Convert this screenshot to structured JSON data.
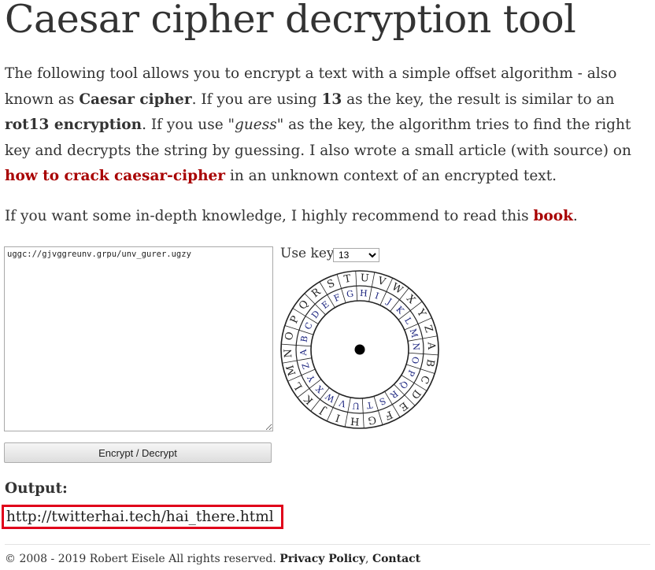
{
  "page": {
    "title": "Caesar cipher decryption tool"
  },
  "intro": {
    "t1": "The following tool allows you to encrypt a text with a simple offset algorithm - also known as ",
    "b1": "Caesar cipher",
    "t2": ". If you are using ",
    "b2": "13",
    "t3": " as the key, the result is similar to an ",
    "b3": "rot13 encryption",
    "t4": ". If you use ",
    "i1": "\"guess\"",
    "t5": " as the key, the algorithm tries to find the right key and decrypts the string by guessing. I also wrote a small article (with source) on ",
    "link1": "how to crack caesar-cipher",
    "t6": " in an unknown context of an encrypted text."
  },
  "intro2": {
    "t1": "If you want some in-depth knowledge, I highly recommend to read this ",
    "link": "book",
    "t2": "."
  },
  "tool": {
    "input_value": "uggc://gjvggreunv.grpu/unv_gurer.ugzy",
    "key_label": "Use key:",
    "key_selected": "13",
    "button_label": "Encrypt / Decrypt",
    "wheel": {
      "outer_letters": [
        "A",
        "B",
        "C",
        "D",
        "E",
        "F",
        "G",
        "H",
        "I",
        "J",
        "K",
        "L",
        "M",
        "N",
        "O",
        "P",
        "Q",
        "R",
        "S",
        "T",
        "U",
        "V",
        "W",
        "X",
        "Y",
        "Z"
      ],
      "inner_letters": [
        "N",
        "O",
        "P",
        "Q",
        "R",
        "S",
        "T",
        "U",
        "V",
        "W",
        "X",
        "Y",
        "Z",
        "A",
        "B",
        "C",
        "D",
        "E",
        "F",
        "G",
        "H",
        "I",
        "J",
        "K",
        "L",
        "M"
      ],
      "accent_color": "#1a237e"
    }
  },
  "output": {
    "label": "Output:",
    "value": "http://twitterhai.tech/hai_there.html",
    "highlight_color": "#e0001a"
  },
  "footer": {
    "copyright": "© 2008 - 2019 Robert Eisele All rights reserved. ",
    "privacy": "Privacy Policy",
    "sep": ", ",
    "contact": "Contact"
  }
}
